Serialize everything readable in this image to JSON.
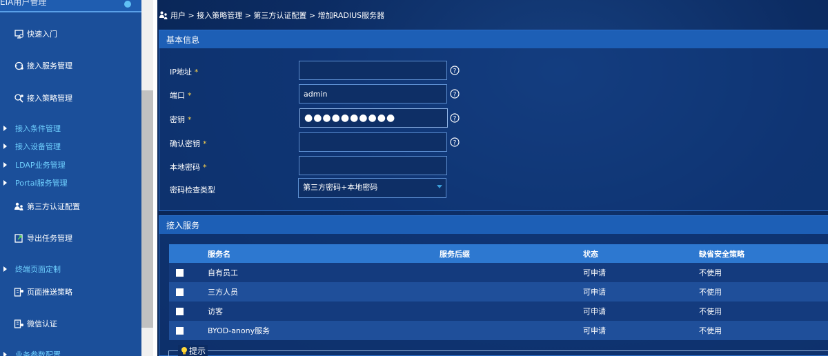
{
  "sidebar": {
    "top_title": "EIA用户管理",
    "items": [
      {
        "label": "快速入门",
        "icon": "quickstart-icon",
        "kind": "main"
      },
      {
        "label": "接入服务管理",
        "icon": "service-icon",
        "kind": "main"
      },
      {
        "label": "接入策略管理",
        "icon": "policy-icon",
        "kind": "main"
      },
      {
        "label": "接入条件管理",
        "kind": "sub"
      },
      {
        "label": "接入设备管理",
        "kind": "sub"
      },
      {
        "label": "LDAP业务管理",
        "kind": "sub"
      },
      {
        "label": "Portal服务管理",
        "kind": "sub"
      },
      {
        "label": "第三方认证配置",
        "icon": "third-party-auth-icon",
        "kind": "main"
      },
      {
        "label": "导出任务管理",
        "icon": "export-icon",
        "kind": "main"
      },
      {
        "label": "终端页面定制",
        "kind": "sub"
      },
      {
        "label": "页面推送策略",
        "icon": "push-policy-icon",
        "kind": "main"
      },
      {
        "label": "微信认证",
        "icon": "wechat-auth-icon",
        "kind": "main"
      },
      {
        "label": "业务参数配置",
        "kind": "sub"
      }
    ]
  },
  "breadcrumb": {
    "text": "用户 > 接入策略管理 > 第三方认证配置 > 增加RADIUS服务器"
  },
  "basic_info": {
    "title": "基本信息",
    "required_mark": "*",
    "ip": {
      "label": "IP地址",
      "value": ""
    },
    "port": {
      "label": "端口",
      "value": "admin"
    },
    "secret": {
      "label": "密钥",
      "value": "●●●●●●●●●●"
    },
    "confirm_secret": {
      "label": "确认密钥",
      "value": ""
    },
    "local_password": {
      "label": "本地密码",
      "value": ""
    },
    "password_check": {
      "label": "密码检查类型",
      "selected": "第三方密码+本地密码"
    }
  },
  "access_service": {
    "title": "接入服务",
    "columns": [
      "服务名",
      "服务后缀",
      "状态",
      "缺省安全策略"
    ],
    "rows": [
      {
        "name": "自有员工",
        "suffix": "",
        "status": "可申请",
        "policy": "不使用"
      },
      {
        "name": "三方人员",
        "suffix": "",
        "status": "可申请",
        "policy": "不使用"
      },
      {
        "name": "访客",
        "suffix": "",
        "status": "可申请",
        "policy": "不使用"
      },
      {
        "name": "BYOD-anony服务",
        "suffix": "",
        "status": "可申请",
        "policy": "不使用"
      }
    ]
  },
  "tip": {
    "label": "提示"
  },
  "colors": {
    "sidebar_bg": "#1b4f9a",
    "panel_header": "#1d5fb6",
    "table_header": "#2d78d0",
    "sub_link": "#6fd0ff",
    "required": "#ffd54a"
  }
}
